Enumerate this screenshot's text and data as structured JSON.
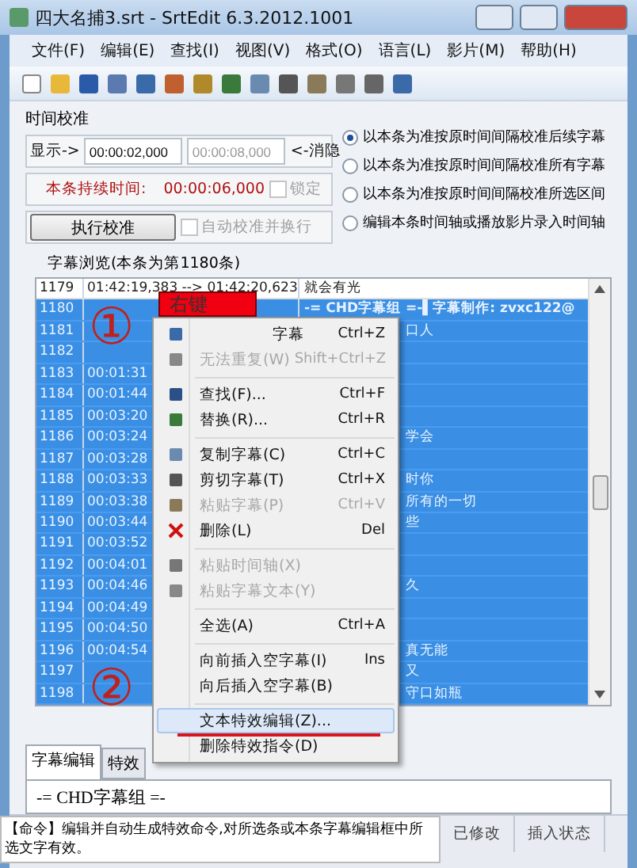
{
  "window": {
    "title": "四大名捕3.srt - SrtEdit 6.3.2012.1001"
  },
  "menu_bar": [
    "文件(F)",
    "编辑(E)",
    "查找(I)",
    "视图(V)",
    "格式(O)",
    "语言(L)",
    "影片(M)",
    "帮助(H)"
  ],
  "time_calibration": {
    "title": "时间校准",
    "show_label": "显示->",
    "start": "00:00:02,000",
    "end": "00:00:08,000",
    "hide_label": "<-消隐",
    "duration_label": "本条持续时间:",
    "duration": "00:00:06,000",
    "lock": {
      "label": "锁定",
      "checked": false,
      "disabled": true
    },
    "run_button": "执行校准",
    "auto": {
      "label": "自动校准并换行",
      "checked": false,
      "disabled": true
    },
    "options": [
      {
        "label": "以本条为准按原时间间隔校准后续字幕",
        "selected": true
      },
      {
        "label": "以本条为准按原时间间隔校准所有字幕",
        "selected": false
      },
      {
        "label": "以本条为准按原时间间隔校准所选区间",
        "selected": false
      },
      {
        "label": "编辑本条时间轴或播放影片录入时间轴",
        "selected": false
      }
    ]
  },
  "browser": {
    "title": "字幕浏览(本条为第1180条)",
    "rows": [
      {
        "number": "1179",
        "time": "01:42:19,383 --> 01:42:20,623",
        "text": "就会有光",
        "selected": false
      },
      {
        "number": "1180",
        "text": "-= CHD字幕组 =-▌字幕制作: zvxc122@",
        "selected": true
      },
      {
        "number": "1181",
        "text": "口人",
        "selected": true
      },
      {
        "number": "1182",
        "selected": true
      },
      {
        "number": "1183",
        "time": "00:01:31",
        "selected": true
      },
      {
        "number": "1184",
        "time": "00:01:44",
        "selected": true
      },
      {
        "number": "1185",
        "time": "00:03:20",
        "selected": true
      },
      {
        "number": "1186",
        "time": "00:03:24",
        "text": "学会",
        "selected": true
      },
      {
        "number": "1187",
        "time": "00:03:28",
        "selected": true
      },
      {
        "number": "1188",
        "time": "00:03:33",
        "text": "时你",
        "selected": true
      },
      {
        "number": "1189",
        "time": "00:03:38",
        "text": "所有的一切",
        "selected": true
      },
      {
        "number": "1190",
        "time": "00:03:44",
        "text": "些",
        "selected": true
      },
      {
        "number": "1191",
        "time": "00:03:52",
        "selected": true
      },
      {
        "number": "1192",
        "time": "00:04:01",
        "selected": true
      },
      {
        "number": "1193",
        "time": "00:04:46",
        "text": "久",
        "selected": true
      },
      {
        "number": "1194",
        "time": "00:04:49",
        "selected": true
      },
      {
        "number": "1195",
        "time": "00:04:50",
        "selected": true
      },
      {
        "number": "1196",
        "time": "00:04:54",
        "text": "真无能",
        "selected": true
      },
      {
        "number": "1197",
        "text": "又",
        "selected": true
      },
      {
        "number": "1198",
        "text": "守口如瓶",
        "selected": true
      }
    ]
  },
  "context_menu": [
    {
      "kind": "item",
      "label": "字幕",
      "shortcut": "Ctrl+Z",
      "disabled": false,
      "selected": false
    },
    {
      "kind": "item",
      "label": "无法重复(W)",
      "shortcut": "Shift+Ctrl+Z",
      "disabled": true,
      "selected": false
    },
    {
      "kind": "separator"
    },
    {
      "kind": "item",
      "label": "查找(F)...",
      "shortcut": "Ctrl+F",
      "disabled": false,
      "selected": false
    },
    {
      "kind": "item",
      "label": "替换(R)...",
      "shortcut": "Ctrl+R",
      "disabled": false,
      "selected": false
    },
    {
      "kind": "separator"
    },
    {
      "kind": "item",
      "label": "复制字幕(C)",
      "shortcut": "Ctrl+C",
      "disabled": false,
      "selected": false
    },
    {
      "kind": "item",
      "label": "剪切字幕(T)",
      "shortcut": "Ctrl+X",
      "disabled": false,
      "selected": false
    },
    {
      "kind": "item",
      "label": "粘贴字幕(P)",
      "shortcut": "Ctrl+V",
      "disabled": true,
      "selected": false
    },
    {
      "kind": "item",
      "label": "删除(L)",
      "shortcut": "Del",
      "disabled": false,
      "selected": false
    },
    {
      "kind": "separator"
    },
    {
      "kind": "item",
      "label": "粘贴时间轴(X)",
      "disabled": true,
      "selected": false
    },
    {
      "kind": "item",
      "label": "粘贴字幕文本(Y)",
      "disabled": true,
      "selected": false
    },
    {
      "kind": "separator"
    },
    {
      "kind": "item",
      "label": "全选(A)",
      "shortcut": "Ctrl+A",
      "disabled": false,
      "selected": false
    },
    {
      "kind": "separator"
    },
    {
      "kind": "item",
      "label": "向前插入空字幕(I)",
      "shortcut": "Ins",
      "disabled": false,
      "selected": false
    },
    {
      "kind": "item",
      "label": "向后插入空字幕(B)",
      "disabled": false,
      "selected": false
    },
    {
      "kind": "separator"
    },
    {
      "kind": "item",
      "label": "文本特效编辑(Z)...",
      "disabled": false,
      "selected": true
    },
    {
      "kind": "item",
      "label": "删除特效指令(D)",
      "disabled": false,
      "selected": false
    }
  ],
  "editor": {
    "tabs": [
      {
        "label": "字幕编辑",
        "selected": true
      },
      {
        "label": "特效",
        "selected": false
      }
    ],
    "value": "-= CHD字幕组 =-"
  },
  "status_bar": {
    "hint": "【命令】编辑并自动生成特效命令,对所选条或本条字幕编辑框中所选文字有效。",
    "modified": "已修改",
    "mode": "插入状态"
  },
  "annotations": {
    "step_one": "①",
    "step_two": "②",
    "callout": "右键"
  }
}
